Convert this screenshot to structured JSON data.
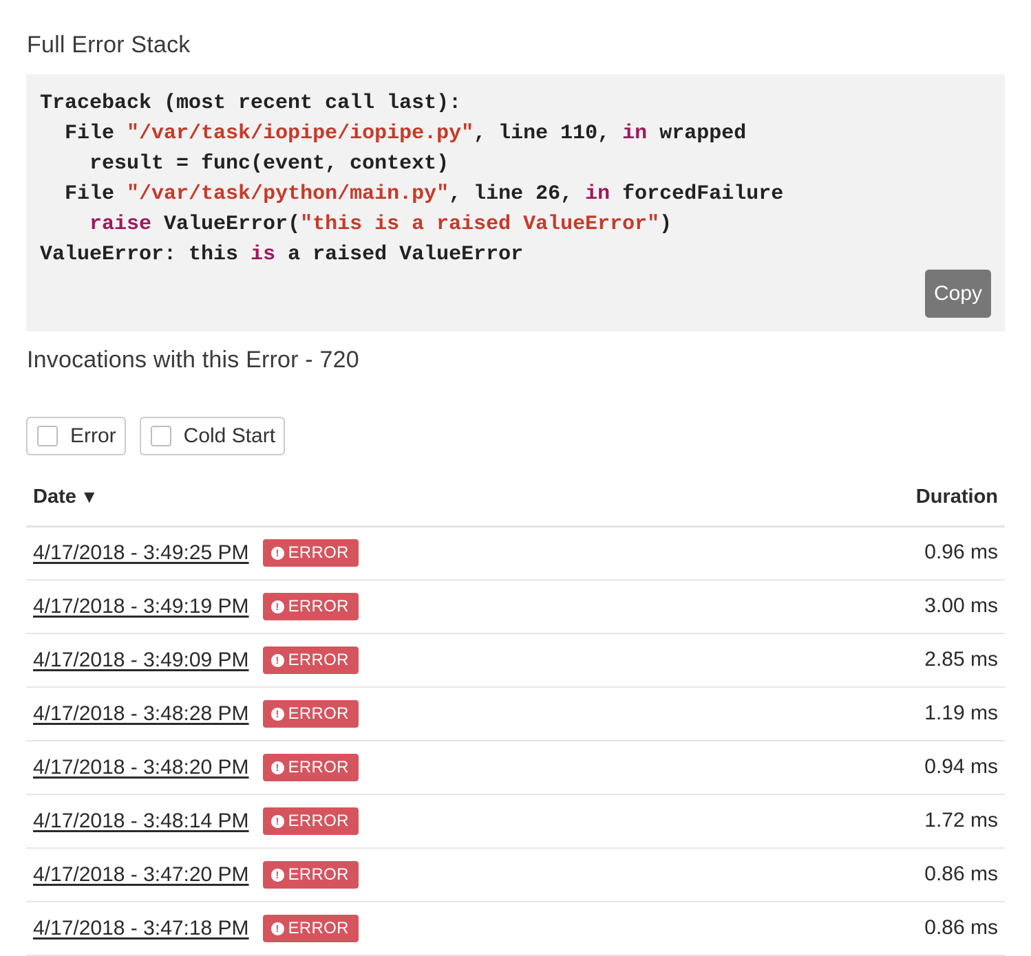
{
  "stack": {
    "title": "Full Error Stack",
    "copy_label": "Copy",
    "lines": [
      [
        {
          "t": "Traceback (most recent call last):",
          "c": ""
        }
      ],
      [
        {
          "t": "  File ",
          "c": ""
        },
        {
          "t": "\"/var/task/iopipe/iopipe.py\"",
          "c": "str"
        },
        {
          "t": ", line 110, ",
          "c": ""
        },
        {
          "t": "in",
          "c": "kw"
        },
        {
          "t": " wrapped",
          "c": ""
        }
      ],
      [
        {
          "t": "    result = func(event, context)",
          "c": ""
        }
      ],
      [
        {
          "t": "  File ",
          "c": ""
        },
        {
          "t": "\"/var/task/python/main.py\"",
          "c": "str"
        },
        {
          "t": ", line 26, ",
          "c": ""
        },
        {
          "t": "in",
          "c": "kw"
        },
        {
          "t": " forcedFailure",
          "c": ""
        }
      ],
      [
        {
          "t": "    ",
          "c": ""
        },
        {
          "t": "raise",
          "c": "kw"
        },
        {
          "t": " ValueError(",
          "c": ""
        },
        {
          "t": "\"this is a raised ValueError\"",
          "c": "str"
        },
        {
          "t": ")",
          "c": ""
        }
      ],
      [
        {
          "t": "ValueError: this ",
          "c": ""
        },
        {
          "t": "is",
          "c": "kw"
        },
        {
          "t": " a raised ValueError",
          "c": ""
        }
      ]
    ]
  },
  "invocations": {
    "title": "Invocations with this Error - 720"
  },
  "filters": [
    {
      "label": "Error",
      "checked": false
    },
    {
      "label": "Cold Start",
      "checked": false
    }
  ],
  "table": {
    "date_header": "Date",
    "sort_icon": "▼",
    "duration_header": "Duration",
    "badge_label": "ERROR",
    "badge_icon": "!",
    "rows": [
      {
        "date": "4/17/2018 - 3:49:25 PM",
        "duration": "0.96 ms"
      },
      {
        "date": "4/17/2018 - 3:49:19 PM",
        "duration": "3.00 ms"
      },
      {
        "date": "4/17/2018 - 3:49:09 PM",
        "duration": "2.85 ms"
      },
      {
        "date": "4/17/2018 - 3:48:28 PM",
        "duration": "1.19 ms"
      },
      {
        "date": "4/17/2018 - 3:48:20 PM",
        "duration": "0.94 ms"
      },
      {
        "date": "4/17/2018 - 3:48:14 PM",
        "duration": "1.72 ms"
      },
      {
        "date": "4/17/2018 - 3:47:20 PM",
        "duration": "0.86 ms"
      },
      {
        "date": "4/17/2018 - 3:47:18 PM",
        "duration": "0.86 ms"
      }
    ]
  },
  "colors": {
    "badge_bg": "#d6545e",
    "code_bg": "#f2f2f2",
    "string": "#c63a2a",
    "keyword": "#a0185c",
    "copy_button": "#777777"
  }
}
